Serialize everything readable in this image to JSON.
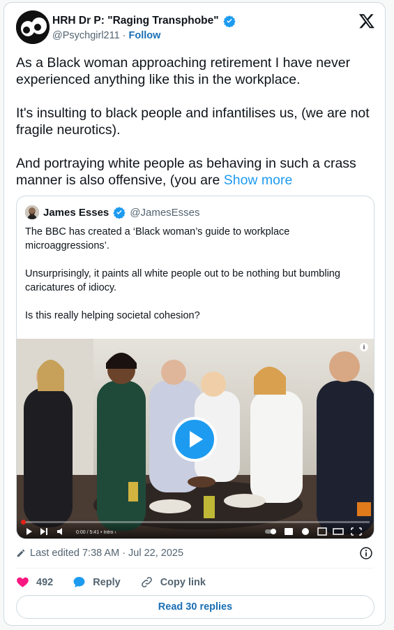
{
  "author": {
    "name": "HRH Dr P: \"Raging Transphobe\"",
    "handle": "@Psychgirl211",
    "separator": "·",
    "follow_label": "Follow",
    "verified": true
  },
  "tweet": {
    "paragraphs": [
      "As a Black woman approaching retirement I have never experienced anything like this in the workplace.",
      "It's insulting to black people and infantilises us, (we are not fragile neurotics).",
      "And portraying white people as behaving in such a crass manner is also offensive, (you are"
    ],
    "show_more": "Show more"
  },
  "quoted": {
    "name": "James Esses",
    "handle": "@JamesEsses",
    "paragraphs": [
      "The BBC has created a ‘Black woman’s guide to workplace microaggressions’.",
      "Unsurprisingly, it paints all white people out to be nothing but bumbling caricatures of idiocy.",
      "Is this really helping societal cohesion?"
    ],
    "video": {
      "time": "0:00 / 5:41 • Intro ›",
      "progress": 0.0
    }
  },
  "meta": {
    "edited": "Last edited 7:38 AM · Jul 22, 2025"
  },
  "actions": {
    "likes": "492",
    "reply": "Reply",
    "copy_link": "Copy link"
  },
  "replies_button": "Read 30 replies",
  "colors": {
    "accent": "#1d9bf0",
    "like": "#f91880",
    "text_secondary": "#536471"
  }
}
